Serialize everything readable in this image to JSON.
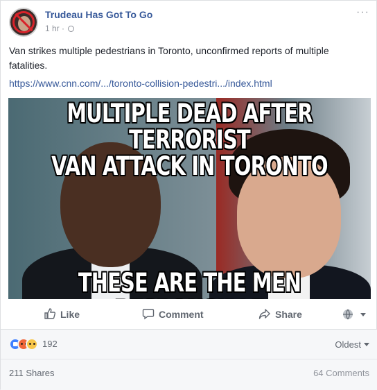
{
  "post": {
    "page_name": "Trudeau Has Got To Go",
    "timestamp": "1 hr",
    "separator": " · ",
    "privacy_icon": "globe-icon",
    "more_icon": "more-options-icon",
    "more_label": "···",
    "text": "Van strikes multiple pedestrians in Toronto, unconfirmed reports of multiple fatalities.",
    "link": "https://www.cnn.com/.../toronto-collision-pedestri.../index.html"
  },
  "image": {
    "top_caption_line1": "MULTIPLE DEAD AFTER TERRORIST",
    "top_caption_line2": "VAN ATTACK IN TORONTO",
    "bottom_caption": "THESE ARE THE MEN RESPONSIBLE"
  },
  "actions": {
    "like_label": "Like",
    "comment_label": "Comment",
    "share_label": "Share",
    "like_icon": "thumbs-up-icon",
    "comment_icon": "speech-bubble-icon",
    "share_icon": "share-arrow-icon",
    "view_as_icon": "globe-selector-icon"
  },
  "engagement": {
    "reaction_icons": [
      "like-reaction-icon",
      "angry-reaction-icon",
      "sad-reaction-icon"
    ],
    "reaction_count": "192",
    "sort_label": "Oldest",
    "shares": "211 Shares",
    "comments": "64 Comments"
  },
  "colors": {
    "link": "#365899",
    "meta": "#90949c",
    "action": "#616770",
    "like_reaction": "#4080ff",
    "angry_reaction": "#f0663a",
    "sad_reaction": "#f7c64a"
  }
}
